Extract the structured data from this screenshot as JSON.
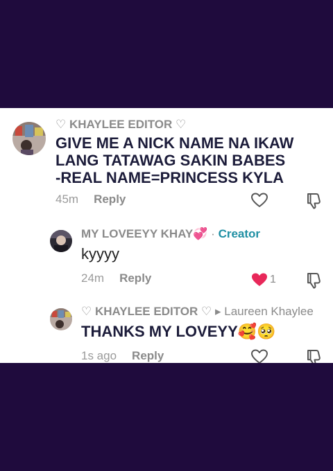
{
  "comments": [
    {
      "username": "♡ KHAYLEE EDITOR ♡",
      "text_lines": [
        "GIVE ME A NICK NAME NA IKAW",
        "LANG TATAWAG SAKIN BABES",
        "-REAL NAME=PRINCESS KYLA"
      ],
      "time": "45m",
      "reply_label": "Reply",
      "liked": false
    },
    {
      "username": "MY LOVEEYY KHAY💞",
      "separator": "·",
      "badge": "Creator",
      "text": "kyyyy",
      "time": "24m",
      "reply_label": "Reply",
      "liked": true,
      "like_count": "1"
    },
    {
      "username": "♡ KHAYLEE EDITOR ♡",
      "reply_arrow": "▸",
      "reply_to": "Laureen Khaylee",
      "text": "THANKS MY LOVEYY🥰🥺",
      "time": "1s ago",
      "reply_label": "Reply",
      "liked": false
    }
  ],
  "colors": {
    "background": "#1f0b3d",
    "panel": "#ffffff",
    "text": "#1c1c3a",
    "muted": "#8a8a8a",
    "creator": "#1e8fa3",
    "like": "#e8285a"
  },
  "icons": [
    "heart-outline-icon",
    "heart-filled-icon",
    "dislike-icon",
    "reply-arrow-icon"
  ]
}
